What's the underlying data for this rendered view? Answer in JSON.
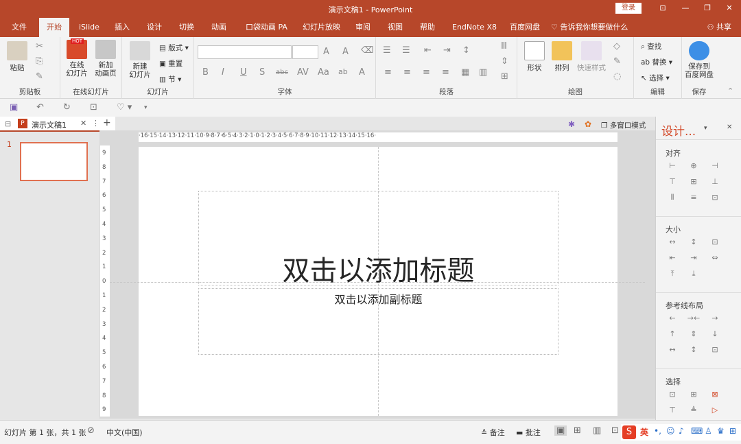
{
  "window": {
    "title": "演示文稿1 - PowerPoint",
    "login": "登录"
  },
  "colors": {
    "accent": "#b7472a",
    "accent_text": "#d24726",
    "ribbon_bg": "#f3f3f3"
  },
  "tabs": [
    "文件",
    "开始",
    "iSlide",
    "插入",
    "设计",
    "切换",
    "动画",
    "口袋动画 PA",
    "幻灯片放映",
    "审阅",
    "视图",
    "帮助",
    "EndNote X8",
    "百度网盘"
  ],
  "tell_me": "告诉我你想要做什么",
  "share": "共享",
  "ribbon": {
    "clipboard": {
      "paste": "粘贴",
      "label": "剪贴板"
    },
    "online": {
      "online_slide": "在线\n幻灯片",
      "new_page": "新加\n动画页",
      "hot": "HOT",
      "label": "在线幻灯片"
    },
    "slides": {
      "new_slide": "新建\n幻灯片",
      "layout": "版式",
      "reset": "重置",
      "section": "节",
      "label": "幻灯片"
    },
    "font": {
      "label": "字体",
      "buttons": [
        "B",
        "I",
        "U",
        "S",
        "abc",
        "AV",
        "Aa",
        "ab",
        "A"
      ]
    },
    "paragraph": {
      "label": "段落"
    },
    "drawing": {
      "shapes": "形状",
      "arrange": "排列",
      "quick_styles": "快速样式",
      "label": "绘图"
    },
    "editing": {
      "find": "查找",
      "replace": "替换",
      "select": "选择",
      "label": "编辑"
    },
    "save": {
      "save_to": "保存到\n百度网盘",
      "label": "保存"
    }
  },
  "doc_tab": "演示文稿1",
  "multi_window": "多窗口模式",
  "slide": {
    "number": "1",
    "title_placeholder": "双击以添加标题",
    "subtitle_placeholder": "双击以添加副标题"
  },
  "ruler_h": "·16·15·14·13·12·11·10·9·8·7·6·5·4·3·2·1·0·1·2·3·4·5·6·7·8·9·10·11·12·13·14·15·16·",
  "ruler_v": [
    "9",
    "8",
    "7",
    "6",
    "5",
    "4",
    "3",
    "2",
    "1",
    "0",
    "1",
    "2",
    "3",
    "4",
    "5",
    "6",
    "7",
    "8",
    "9"
  ],
  "right_pane": {
    "title": "设计...",
    "sections": [
      "对齐",
      "大小",
      "参考线布局",
      "选择"
    ]
  },
  "status": {
    "slide_info": "幻灯片 第 1 张，共 1 张",
    "language": "中文(中国)",
    "notes": "备注",
    "comments": "批注"
  },
  "ime": {
    "mode": "英"
  }
}
